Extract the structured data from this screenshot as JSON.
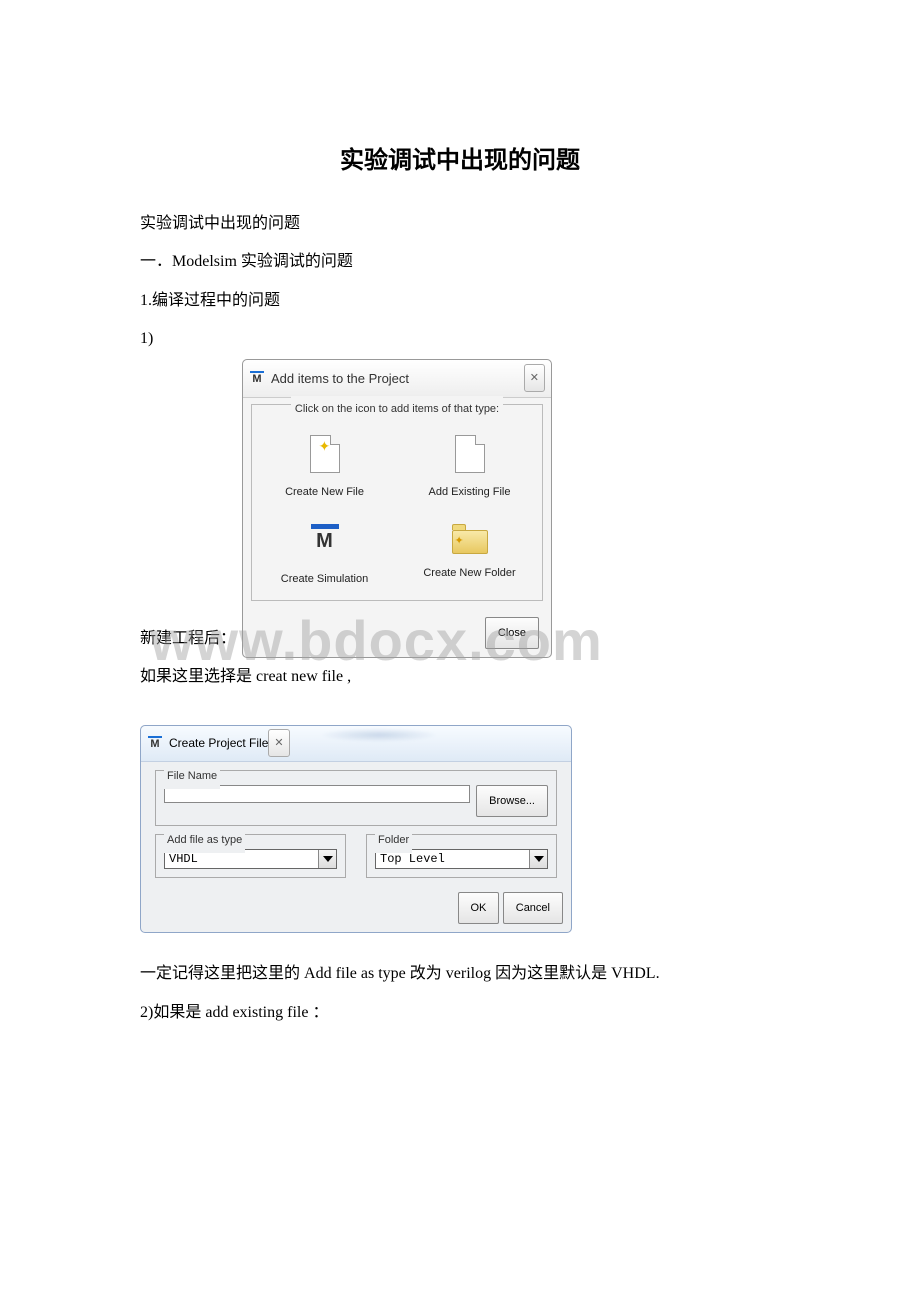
{
  "doc": {
    "title": "实验调试中出现的问题",
    "lines": {
      "l1": "实验调试中出现的问题",
      "l2a": "一．",
      "l2b": "Modelsim ",
      "l2c": "实验调试的问题",
      "l3a": "1.",
      "l3b": "编译过程中的问题",
      "l4": "1)",
      "l5": "新建工程后：",
      "l6a": "如果这里选择是",
      "l6b": " creat new file ,",
      "l7a": "一定记得这里把这里的",
      "l7b": " Add file as type ",
      "l7c": "改为",
      "l7d": " verilog ",
      "l7e": "因为这里默认是",
      "l7f": " VHDL.",
      "l8a": "2)",
      "l8b": "如果是",
      "l8c": " add existing file ",
      "l8d": "："
    }
  },
  "dialog1": {
    "title": "Add items to the Project",
    "close": "✕",
    "legend": "Click on the icon to add items of that type:",
    "items": {
      "create_new_file": "Create New File",
      "add_existing_file": "Add Existing File",
      "create_simulation": "Create Simulation",
      "create_new_folder": "Create New Folder"
    },
    "close_btn": "Close"
  },
  "dialog2": {
    "title": "Create Project File",
    "close": "✕",
    "filename_legend": "File Name",
    "browse": "Browse...",
    "filetype_legend": "Add file as type",
    "filetype_value": "VHDL",
    "folder_legend": "Folder",
    "folder_value": "Top Level",
    "ok": "OK",
    "cancel": "Cancel"
  },
  "watermark": "www.bdocx.com"
}
